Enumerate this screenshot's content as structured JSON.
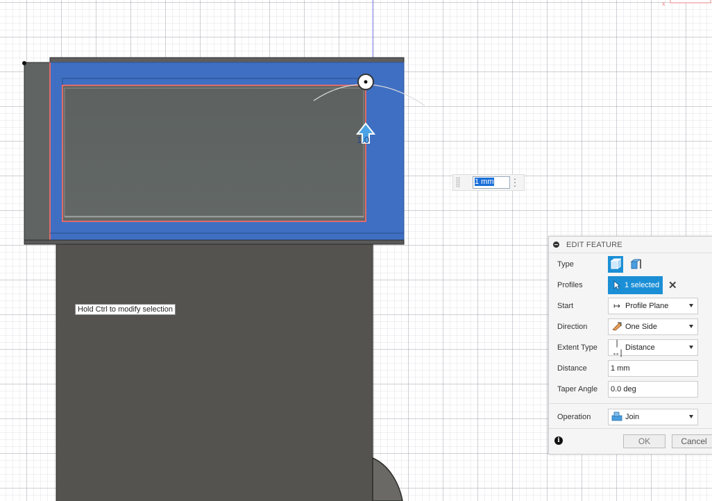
{
  "tooltip": {
    "text": "Hold Ctrl to modify selection"
  },
  "dimension_input": {
    "value": "1 mm"
  },
  "manipulator": {
    "value_label": "1.0"
  },
  "panel": {
    "title": "EDIT FEATURE",
    "type": {
      "label": "Type"
    },
    "profiles": {
      "label": "Profiles",
      "selection": "1 selected"
    },
    "start": {
      "label": "Start",
      "value": "Profile Plane",
      "icon": "profile-plane-icon"
    },
    "direction": {
      "label": "Direction",
      "value": "One Side",
      "icon": "one-side-icon"
    },
    "extent_type": {
      "label": "Extent Type",
      "value": "Distance",
      "icon": "distance-icon"
    },
    "distance": {
      "label": "Distance",
      "value": "1 mm"
    },
    "taper_angle": {
      "label": "Taper Angle",
      "value": "0.0 deg"
    },
    "operation": {
      "label": "Operation",
      "value": "Join",
      "icon": "join-icon"
    },
    "ok_label": "OK",
    "cancel_label": "Cancel"
  },
  "colors": {
    "selection_blue": "#3f6fc2",
    "accent": "#1b8fd6",
    "body_dark": "#55534f",
    "profile_highlight": "#e06b6b"
  }
}
